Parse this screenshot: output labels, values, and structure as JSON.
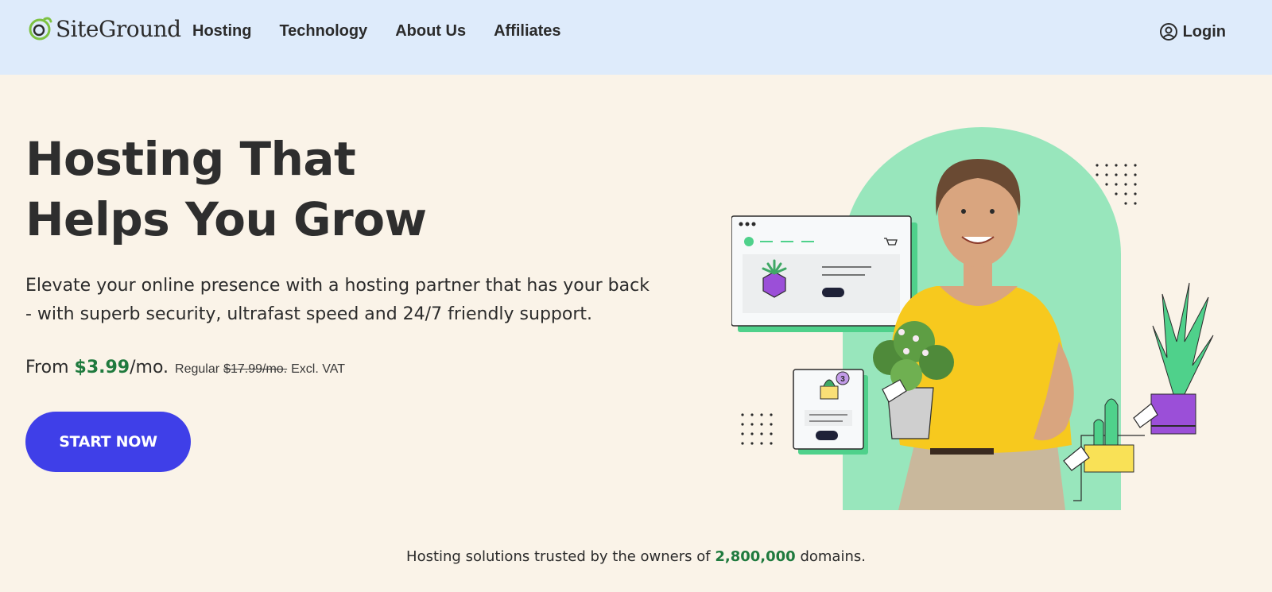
{
  "header": {
    "logo_text": "SiteGround",
    "nav": [
      "Hosting",
      "Technology",
      "About Us",
      "Affiliates"
    ],
    "login_label": "Login"
  },
  "hero": {
    "title_line1": "Hosting That",
    "title_line2": "Helps You Grow",
    "subtitle_line1": "Elevate your online presence with a hosting partner that has your back",
    "subtitle_line2": "- with superb security, ultrafast speed and 24/7 friendly support.",
    "price_from": "From",
    "price_value": "$3.99",
    "price_period": "/mo.",
    "price_regular_label": "Regular",
    "price_regular_value": "$17.99/mo.",
    "price_vat": "Excl. VAT",
    "cta_label": "START NOW",
    "cart_badge": "3"
  },
  "trust": {
    "prefix": "Hosting solutions trusted by the owners of",
    "number": "2,800,000",
    "suffix": "domains."
  },
  "colors": {
    "header_bg": "#deebfb",
    "page_bg": "#faf3e8",
    "cta_bg": "#3f3fe8",
    "price_green": "#1f7a3e",
    "mint": "#98e6bc"
  }
}
